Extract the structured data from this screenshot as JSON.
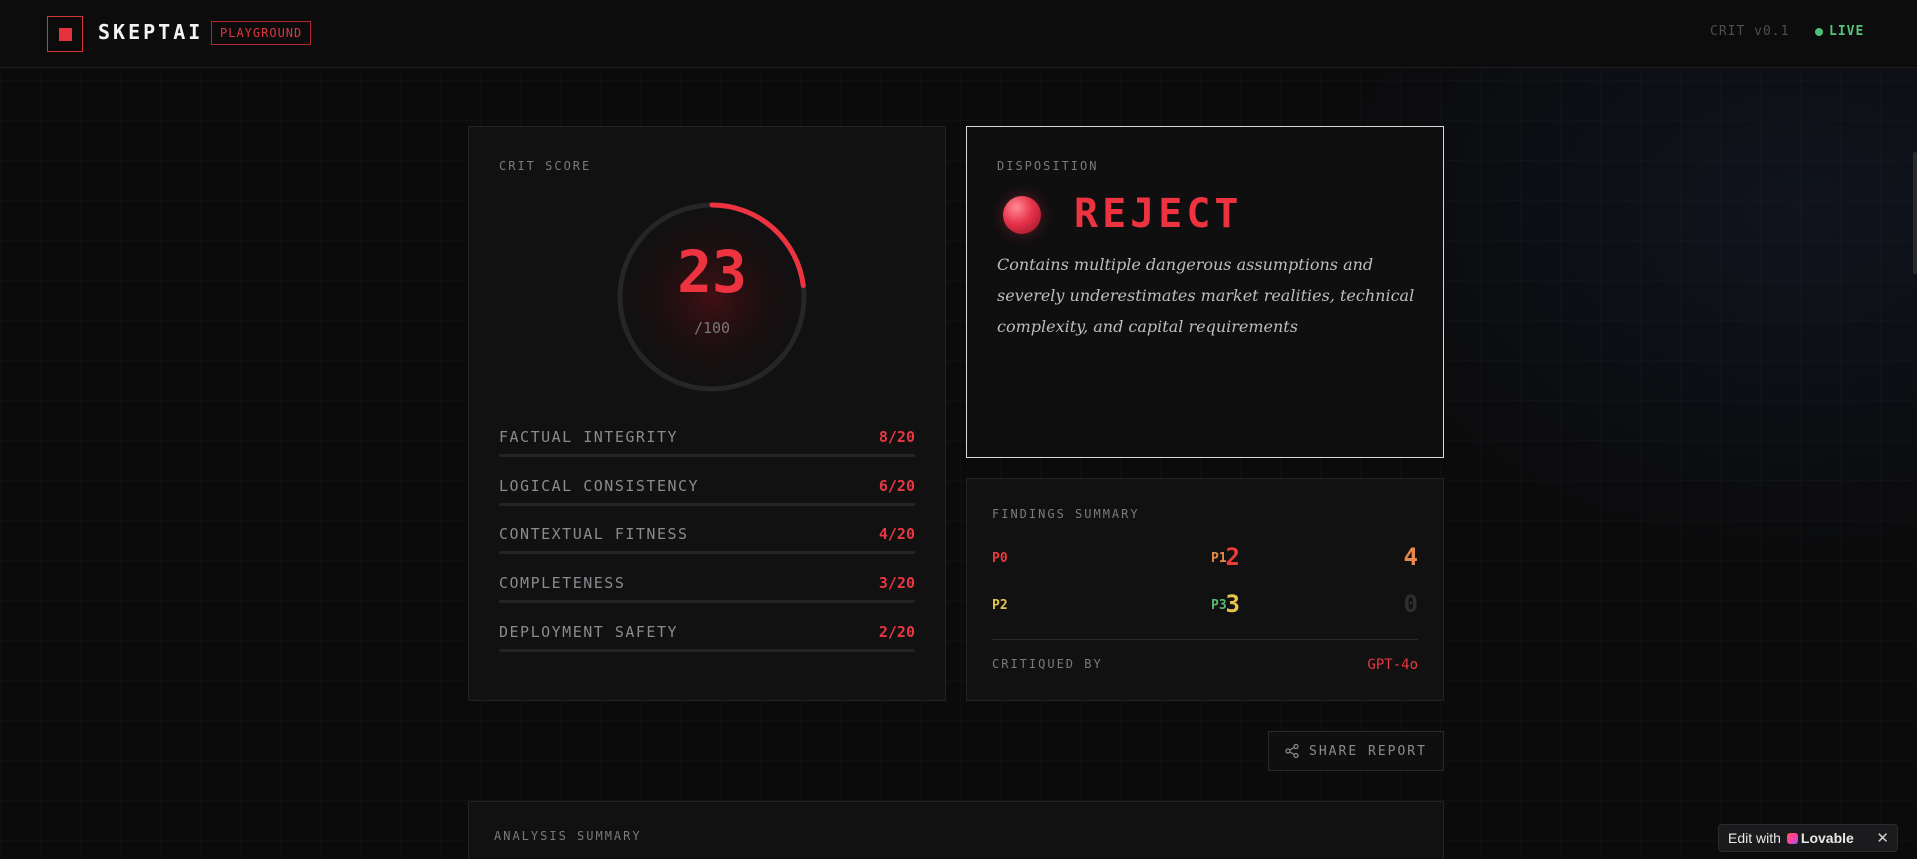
{
  "header": {
    "brand": "SKEPTAI",
    "badge": "PLAYGROUND",
    "version": "CRIT v0.1",
    "status": "LIVE"
  },
  "score": {
    "label": "CRIT SCORE",
    "value": "23",
    "max": "/100",
    "fraction": 0.23,
    "metrics": [
      {
        "name": "FACTUAL INTEGRITY",
        "value": "8/20",
        "fraction": 0.4
      },
      {
        "name": "LOGICAL CONSISTENCY",
        "value": "6/20",
        "fraction": 0.3
      },
      {
        "name": "CONTEXTUAL FITNESS",
        "value": "4/20",
        "fraction": 0.2
      },
      {
        "name": "COMPLETENESS",
        "value": "3/20",
        "fraction": 0.15
      },
      {
        "name": "DEPLOYMENT SAFETY",
        "value": "2/20",
        "fraction": 0.1
      }
    ]
  },
  "disposition": {
    "label": "DISPOSITION",
    "verdict": "REJECT",
    "description": "Contains multiple dangerous assumptions and severely underestimates market realities, technical complexity, and capital requirements"
  },
  "findings": {
    "label": "FINDINGS SUMMARY",
    "p0": {
      "label": "P0",
      "count": "2",
      "color": "#ea3a3a"
    },
    "p1": {
      "label": "P1",
      "count": "4",
      "color": "#e8894a"
    },
    "p2": {
      "label": "P2",
      "count": "3",
      "color": "#e8c44a"
    },
    "p3": {
      "label": "P3",
      "count": "0",
      "color": "#57b96f"
    },
    "critiqued_by_label": "CRITIQUED BY",
    "critiqued_by": "GPT-4o"
  },
  "actions": {
    "share_label": "SHARE REPORT"
  },
  "analysis": {
    "label": "ANALYSIS SUMMARY"
  },
  "lovable": {
    "edit_label": "Edit with",
    "brand": "Lovable",
    "close": "✕"
  },
  "colors": {
    "accent": "#ee3340",
    "live": "#55c27a",
    "bar_fill": "#e53844"
  }
}
